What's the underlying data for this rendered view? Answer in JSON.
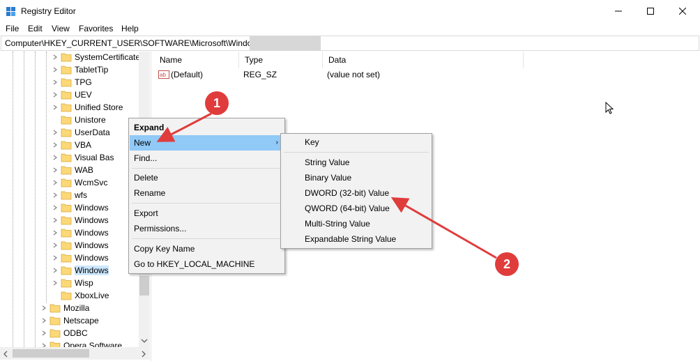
{
  "window": {
    "title": "Registry Editor"
  },
  "menu": [
    "File",
    "Edit",
    "View",
    "Favorites",
    "Help"
  ],
  "address": {
    "path": "Computer\\HKEY_CURRENT_USER\\SOFTWARE\\Microsoft\\Windows"
  },
  "tree": {
    "items": [
      {
        "label": "SystemCertificate"
      },
      {
        "label": "TabletTip"
      },
      {
        "label": "TPG"
      },
      {
        "label": "UEV"
      },
      {
        "label": "Unified Store"
      },
      {
        "label": "Unistore"
      },
      {
        "label": "UserData"
      },
      {
        "label": "VBA"
      },
      {
        "label": "Visual Bas"
      },
      {
        "label": "WAB"
      },
      {
        "label": "WcmSvc"
      },
      {
        "label": "wfs"
      },
      {
        "label": "Windows"
      },
      {
        "label": "Windows"
      },
      {
        "label": "Windows"
      },
      {
        "label": "Windows"
      },
      {
        "label": "Windows"
      },
      {
        "label": "Windows"
      },
      {
        "label": "Wisp"
      },
      {
        "label": "XboxLive"
      },
      {
        "label": "Mozilla"
      },
      {
        "label": "Netscape"
      },
      {
        "label": "ODBC"
      },
      {
        "label": "Opera Software"
      }
    ]
  },
  "list": {
    "columns": [
      "Name",
      "Type",
      "Data"
    ],
    "rows": [
      {
        "name": "(Default)",
        "type": "REG_SZ",
        "data": "(value not set)"
      }
    ]
  },
  "context_menu": {
    "items": [
      "Expand",
      "New",
      "Find...",
      "Delete",
      "Rename",
      "Export",
      "Permissions...",
      "Copy Key Name",
      "Go to HKEY_LOCAL_MACHINE"
    ],
    "submenu_arrow": "›"
  },
  "submenu": {
    "items": [
      "Key",
      "String Value",
      "Binary Value",
      "DWORD (32-bit) Value",
      "QWORD (64-bit) Value",
      "Multi-String Value",
      "Expandable String Value"
    ]
  },
  "annotations": {
    "badge1": "1",
    "badge2": "2",
    "color": "#e03c3c"
  },
  "icons": {
    "app": "registry-icon",
    "value": "string-value-icon",
    "folder": "folder-icon"
  }
}
